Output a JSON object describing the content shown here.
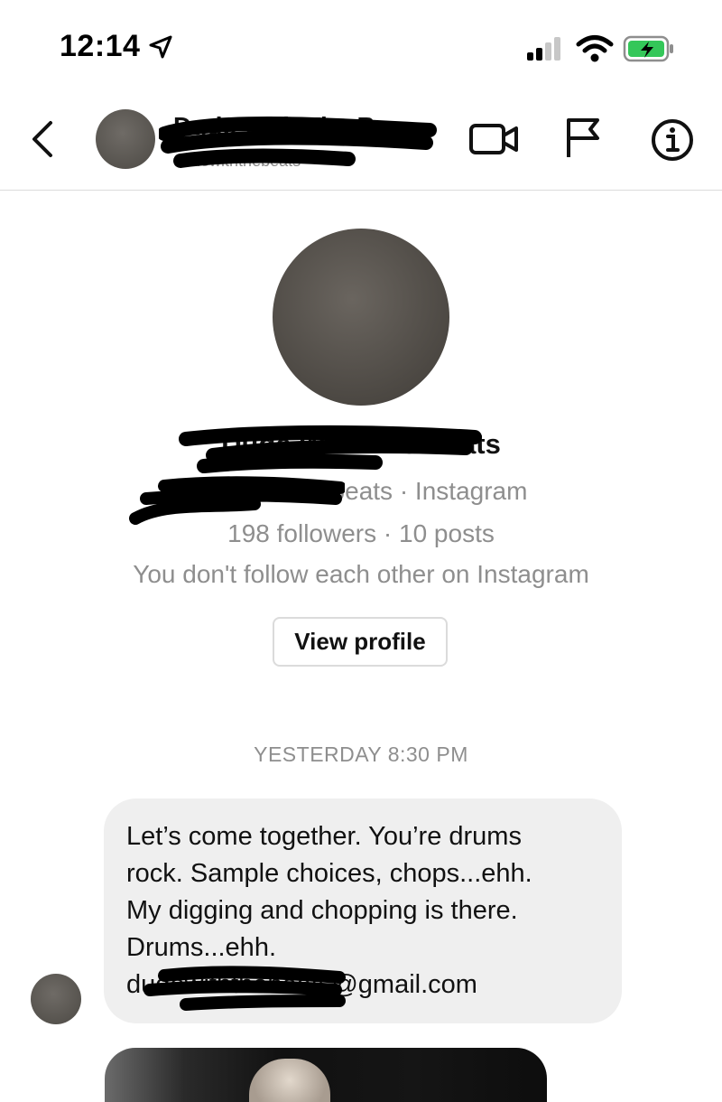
{
  "status_bar": {
    "time": "12:14",
    "location_icon": "location-arrow-icon",
    "signal_icon": "cellular-signal-icon",
    "wifi_icon": "wifi-icon",
    "battery_icon": "battery-charging-icon",
    "battery_color": "#34c759"
  },
  "header": {
    "title": "Dude With The B...",
    "subtitle": "dudewiththebeats",
    "back_icon": "chevron-left-icon",
    "video_icon": "video-camera-icon",
    "report_icon": "flag-icon",
    "info_icon": "info-icon"
  },
  "profile": {
    "name": "Dude With The Beats",
    "handle_line": "dudewiththebeats · Instagram",
    "stats": "198 followers · 10 posts",
    "follow_note": "You don't follow each other on Instagram",
    "view_profile_label": "View profile"
  },
  "chat": {
    "timestamp": "YESTERDAY 8:30 PM",
    "messages": [
      {
        "lines": [
          "Let’s come together. You’re drums",
          "rock. Sample choices, chops...ehh.",
          "My digging and chopping is there.",
          "Drums...ehh.",
          "dudewiththebeats@gmail.com"
        ]
      }
    ]
  }
}
